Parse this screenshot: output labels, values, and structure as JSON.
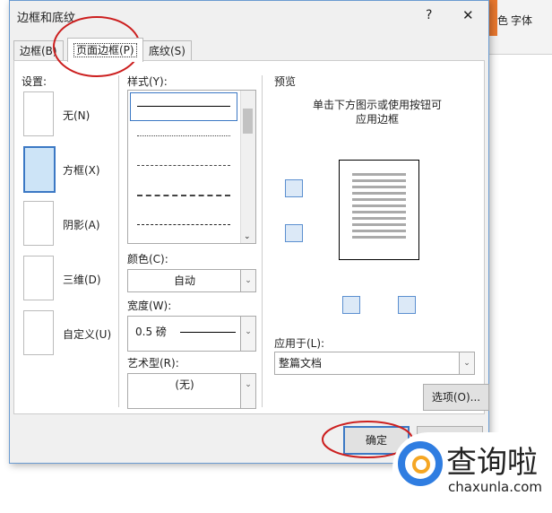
{
  "dialog": {
    "title": "边框和底纹",
    "help": "?",
    "close": "✕"
  },
  "tabs": [
    {
      "label": "边框(B)"
    },
    {
      "label": "页面边框(P)",
      "selected": true
    },
    {
      "label": "底纹(S)"
    }
  ],
  "settings": {
    "label": "设置:",
    "items": [
      {
        "label": "无(N)"
      },
      {
        "label": "方框(X)",
        "selected": true
      },
      {
        "label": "阴影(A)"
      },
      {
        "label": "三维(D)"
      },
      {
        "label": "自定义(U)"
      }
    ]
  },
  "style": {
    "label": "样式(Y):"
  },
  "color": {
    "label": "颜色(C):",
    "value": "自动"
  },
  "width": {
    "label": "宽度(W):",
    "value": "0.5 磅"
  },
  "art": {
    "label": "艺术型(R):",
    "value": "(无)"
  },
  "preview": {
    "label": "预览",
    "hint1": "单击下方图示或使用按钮可",
    "hint2": "应用边框"
  },
  "apply": {
    "label": "应用于(L):",
    "value": "整篇文档"
  },
  "options_button": "选项(O)...",
  "ok_button": "确定",
  "ribbon": {
    "font_label": "字体",
    "color_frag": "色"
  },
  "watermark": {
    "name": "查询啦",
    "url": "chaxunla.com"
  },
  "colors": {
    "accent": "#3b78c4",
    "annotation": "#cc1f1f"
  }
}
